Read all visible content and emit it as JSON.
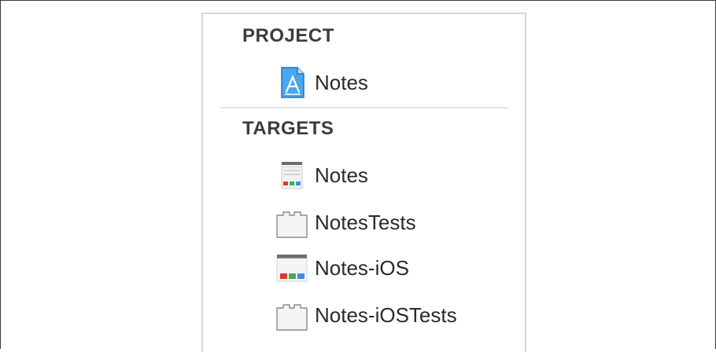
{
  "project": {
    "header": "PROJECT",
    "items": [
      {
        "label": "Notes",
        "icon": "xcode-project-icon"
      }
    ]
  },
  "targets": {
    "header": "TARGETS",
    "items": [
      {
        "label": "Notes",
        "icon": "mac-app-target-icon"
      },
      {
        "label": "NotesTests",
        "icon": "test-bundle-icon"
      },
      {
        "label": "Notes-iOS",
        "icon": "ios-app-target-icon"
      },
      {
        "label": "Notes-iOSTests",
        "icon": "test-bundle-icon"
      }
    ]
  },
  "colors": {
    "header_text": "#3c3c3c",
    "label_text": "#2a2a2a",
    "project_icon_blue": "#2d8de0",
    "block_red": "#e2342f",
    "block_green": "#3bb14a",
    "block_blue": "#3e8ee0"
  }
}
